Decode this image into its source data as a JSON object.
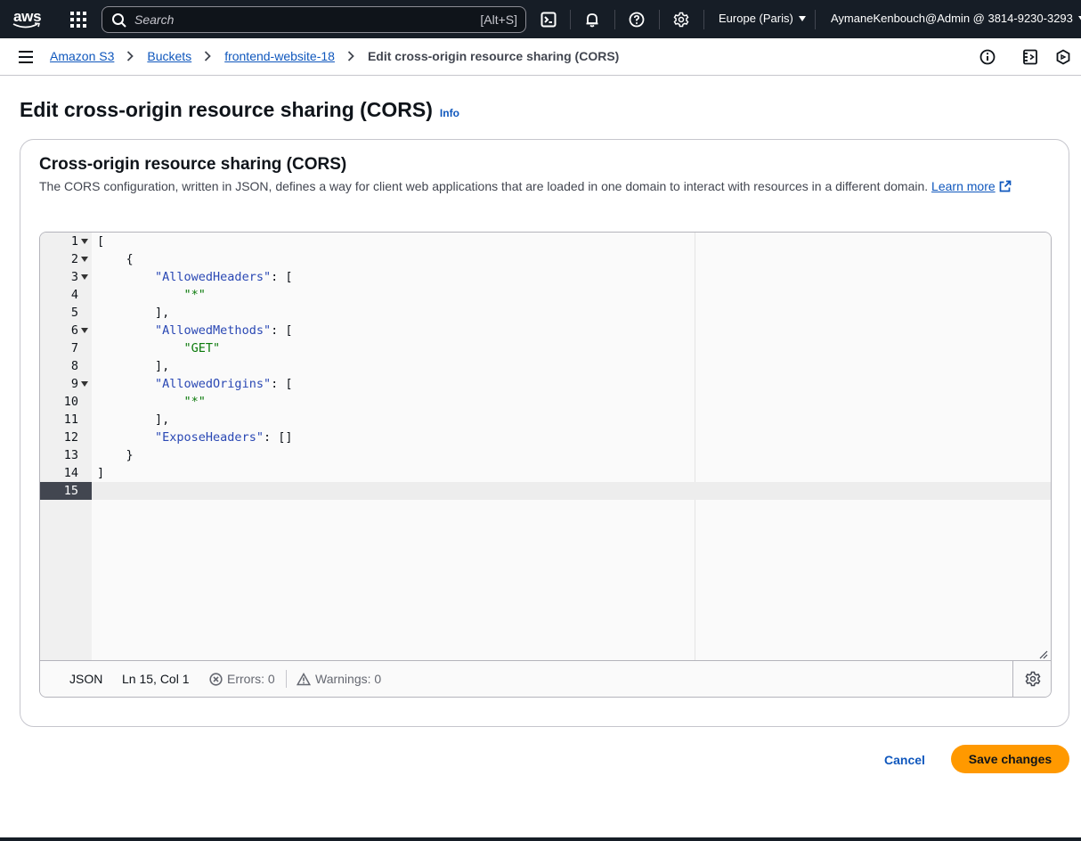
{
  "topnav": {
    "logo_text": "aws",
    "search": {
      "placeholder": "Search",
      "shortcut": "[Alt+S]"
    },
    "region": "Europe (Paris)",
    "account": "AymaneKenbouch@Admin @ 3814-9230-3293",
    "icons": [
      "services-grid-icon",
      "cloudshell-icon",
      "bell-icon",
      "help-icon",
      "settings-gear-icon"
    ]
  },
  "breadcrumb": {
    "items": [
      {
        "label": "Amazon S3"
      },
      {
        "label": "Buckets"
      },
      {
        "label": "frontend-website-18"
      }
    ],
    "current": "Edit cross-origin resource sharing (CORS)"
  },
  "page": {
    "title": "Edit cross-origin resource sharing (CORS)",
    "info_label": "Info"
  },
  "card": {
    "title": "Cross-origin resource sharing (CORS)",
    "description": "The CORS configuration, written in JSON, defines a way for client web applications that are loaded in one domain to interact with resources in a different domain.",
    "learn_more": "Learn more"
  },
  "editor": {
    "lines": [
      {
        "n": "1",
        "fold": true,
        "text": "["
      },
      {
        "n": "2",
        "fold": true,
        "text": "    {"
      },
      {
        "n": "3",
        "fold": true,
        "text": "        \"AllowedHeaders\": ["
      },
      {
        "n": "4",
        "fold": false,
        "text": "            \"*\""
      },
      {
        "n": "5",
        "fold": false,
        "text": "        ],"
      },
      {
        "n": "6",
        "fold": true,
        "text": "        \"AllowedMethods\": ["
      },
      {
        "n": "7",
        "fold": false,
        "text": "            \"GET\""
      },
      {
        "n": "8",
        "fold": false,
        "text": "        ],"
      },
      {
        "n": "9",
        "fold": true,
        "text": "        \"AllowedOrigins\": ["
      },
      {
        "n": "10",
        "fold": false,
        "text": "            \"*\""
      },
      {
        "n": "11",
        "fold": false,
        "text": "        ],"
      },
      {
        "n": "12",
        "fold": false,
        "text": "        \"ExposeHeaders\": []"
      },
      {
        "n": "13",
        "fold": false,
        "text": "    }"
      },
      {
        "n": "14",
        "fold": false,
        "text": "]"
      },
      {
        "n": "15",
        "fold": false,
        "text": "",
        "active": true
      }
    ],
    "status": {
      "mode": "JSON",
      "position": "Ln 15, Col 1",
      "errors": "Errors: 0",
      "warnings": "Warnings: 0"
    }
  },
  "actions": {
    "cancel": "Cancel",
    "save": "Save changes"
  },
  "colors": {
    "nav_bg": "#161d26",
    "link": "#0f57bd",
    "primary_button": "#ff9900",
    "json_key": "#2a48b4",
    "json_string": "#0b7a0b"
  }
}
